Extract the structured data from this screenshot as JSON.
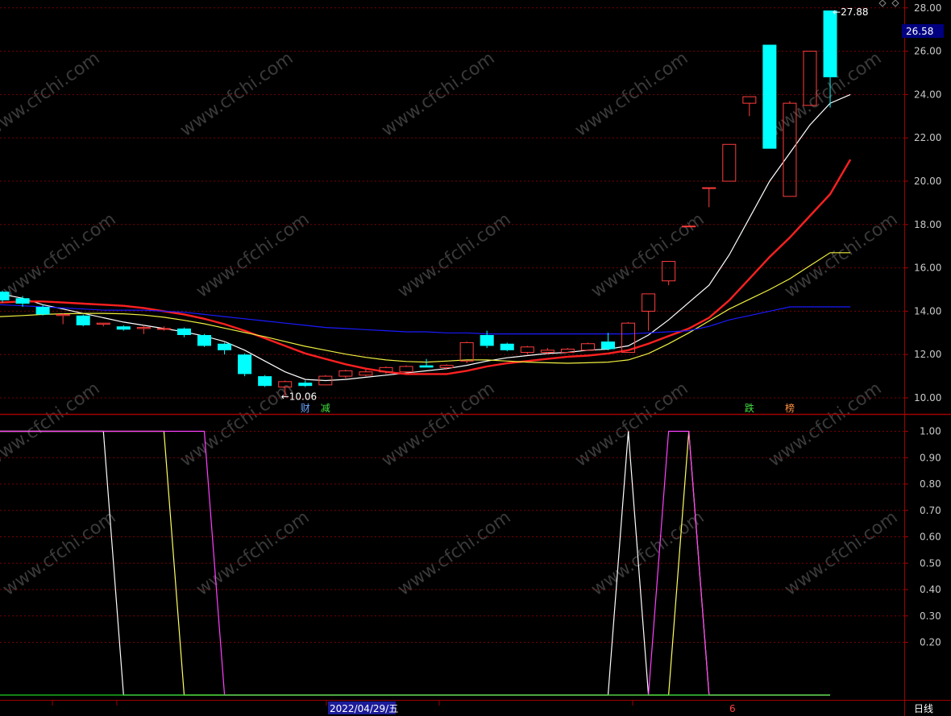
{
  "colors": {
    "background": "#000000",
    "grid": "#7a0000",
    "border": "#a00000",
    "axis_text": "#c8c8c8",
    "up_candle": "#ff3c3c",
    "down_candle": "#00ffff",
    "ma5": "#ffffff",
    "ma10": "#ff2020",
    "ma20": "#f0f040",
    "ma60": "#1a1aff",
    "ind_white": "#ffffff",
    "ind_yellow": "#ffff60",
    "ind_magenta": "#ff40ff",
    "ind_green": "#20d020",
    "price_tag_bg": "#000080"
  },
  "watermark": "www.cfchi.com",
  "labels": {
    "high": "27.88",
    "high_prefix": "←",
    "low": "10.06",
    "low_prefix": "←",
    "current_price": "26.58",
    "date": "2022/04/29/五",
    "period": "日线",
    "axis_marker": "6"
  },
  "event_markers": [
    {
      "text": "财",
      "color": "#6aa6ff",
      "candle": 15
    },
    {
      "text": "减",
      "color": "#40e040",
      "candle": 16
    },
    {
      "text": "跌",
      "color": "#40e040",
      "candle": 37
    },
    {
      "text": "榜",
      "color": "#ff9040",
      "candle": 39
    }
  ],
  "chart_data": [
    {
      "type": "candlestick",
      "title": "",
      "ylim": [
        9.5,
        28.4
      ],
      "yticks": [
        "10.00",
        "12.00",
        "14.00",
        "16.00",
        "18.00",
        "20.00",
        "22.00",
        "24.00",
        "26.00",
        "28.00"
      ],
      "candles": [
        {
          "o": 14.9,
          "h": 14.95,
          "l": 14.4,
          "c": 14.5
        },
        {
          "o": 14.6,
          "h": 14.7,
          "l": 14.2,
          "c": 14.35
        },
        {
          "o": 14.2,
          "h": 14.3,
          "l": 13.8,
          "c": 13.85
        },
        {
          "o": 13.8,
          "h": 13.9,
          "l": 13.4,
          "c": 13.85
        },
        {
          "o": 13.8,
          "h": 13.85,
          "l": 13.3,
          "c": 13.35
        },
        {
          "o": 13.4,
          "h": 13.45,
          "l": 13.3,
          "c": 13.45
        },
        {
          "o": 13.3,
          "h": 13.35,
          "l": 13.1,
          "c": 13.15
        },
        {
          "o": 13.2,
          "h": 13.35,
          "l": 12.95,
          "c": 13.25
        },
        {
          "o": 13.2,
          "h": 13.3,
          "l": 13.1,
          "c": 13.2
        },
        {
          "o": 13.2,
          "h": 13.25,
          "l": 12.8,
          "c": 12.9
        },
        {
          "o": 12.9,
          "h": 12.95,
          "l": 12.35,
          "c": 12.4
        },
        {
          "o": 12.5,
          "h": 12.55,
          "l": 12.0,
          "c": 12.2
        },
        {
          "o": 12.0,
          "h": 12.05,
          "l": 11.0,
          "c": 11.1
        },
        {
          "o": 11.0,
          "h": 11.05,
          "l": 10.5,
          "c": 10.55
        },
        {
          "o": 10.5,
          "h": 10.8,
          "l": 10.06,
          "c": 10.75
        },
        {
          "o": 10.7,
          "h": 10.8,
          "l": 10.5,
          "c": 10.55
        },
        {
          "o": 10.6,
          "h": 11.05,
          "l": 10.6,
          "c": 11.0
        },
        {
          "o": 11.0,
          "h": 11.3,
          "l": 10.9,
          "c": 11.25
        },
        {
          "o": 11.05,
          "h": 11.3,
          "l": 11.0,
          "c": 11.2
        },
        {
          "o": 11.2,
          "h": 11.45,
          "l": 11.1,
          "c": 11.4
        },
        {
          "o": 11.2,
          "h": 11.5,
          "l": 11.2,
          "c": 11.45
        },
        {
          "o": 11.5,
          "h": 11.8,
          "l": 11.4,
          "c": 11.4
        },
        {
          "o": 11.4,
          "h": 11.55,
          "l": 11.3,
          "c": 11.5
        },
        {
          "o": 11.7,
          "h": 12.6,
          "l": 11.6,
          "c": 12.55
        },
        {
          "o": 12.9,
          "h": 13.1,
          "l": 12.3,
          "c": 12.4
        },
        {
          "o": 12.5,
          "h": 12.55,
          "l": 12.15,
          "c": 12.2
        },
        {
          "o": 12.1,
          "h": 12.4,
          "l": 12.0,
          "c": 12.35
        },
        {
          "o": 12.1,
          "h": 12.3,
          "l": 12.0,
          "c": 12.2
        },
        {
          "o": 12.1,
          "h": 12.3,
          "l": 12.1,
          "c": 12.25
        },
        {
          "o": 12.2,
          "h": 12.55,
          "l": 12.2,
          "c": 12.5
        },
        {
          "o": 12.6,
          "h": 13.0,
          "l": 12.2,
          "c": 12.25
        },
        {
          "o": 12.1,
          "h": 13.5,
          "l": 12.1,
          "c": 13.45
        },
        {
          "o": 14.0,
          "h": 14.8,
          "l": 13.1,
          "c": 14.8
        },
        {
          "o": 15.4,
          "h": 16.3,
          "l": 15.2,
          "c": 16.3
        },
        {
          "o": 17.93,
          "h": 17.93,
          "l": 17.93,
          "c": 17.93
        },
        {
          "o": 19.7,
          "h": 19.7,
          "l": 18.8,
          "c": 19.7
        },
        {
          "o": 20.0,
          "h": 21.7,
          "l": 20.0,
          "c": 21.7
        },
        {
          "o": 23.6,
          "h": 23.9,
          "l": 23.0,
          "c": 23.9
        },
        {
          "o": 26.3,
          "h": 26.3,
          "l": 21.5,
          "c": 21.5
        },
        {
          "o": 19.3,
          "h": 23.7,
          "l": 19.3,
          "c": 23.6
        },
        {
          "o": 23.5,
          "h": 26.0,
          "l": 23.5,
          "c": 26.0
        },
        {
          "o": 27.88,
          "h": 27.88,
          "l": 23.4,
          "c": 24.8
        }
      ],
      "series": [
        {
          "name": "MA5",
          "values": [
            14.8,
            14.6,
            14.3,
            14.1,
            13.9,
            13.7,
            13.5,
            13.35,
            13.2,
            13.05,
            12.85,
            12.6,
            12.2,
            11.7,
            11.2,
            10.85,
            10.8,
            10.85,
            10.95,
            11.05,
            11.15,
            11.25,
            11.35,
            11.5,
            11.7,
            11.85,
            11.95,
            12.05,
            12.1,
            12.2,
            12.25,
            12.4,
            12.9,
            13.6,
            14.4,
            15.2,
            16.6,
            18.3,
            20.0,
            21.3,
            22.6,
            23.6,
            24.0
          ]
        },
        {
          "name": "MA10",
          "values": [
            14.4,
            14.45,
            14.45,
            14.4,
            14.35,
            14.3,
            14.25,
            14.15,
            14.0,
            13.85,
            13.65,
            13.4,
            13.1,
            12.75,
            12.4,
            12.05,
            11.8,
            11.55,
            11.35,
            11.2,
            11.1,
            11.1,
            11.1,
            11.25,
            11.45,
            11.6,
            11.7,
            11.8,
            11.9,
            11.95,
            12.05,
            12.2,
            12.5,
            12.85,
            13.2,
            13.7,
            14.5,
            15.5,
            16.5,
            17.4,
            18.4,
            19.4,
            21.0
          ]
        },
        {
          "name": "MA20",
          "values": [
            13.75,
            13.8,
            13.85,
            13.88,
            13.9,
            13.9,
            13.88,
            13.82,
            13.72,
            13.58,
            13.42,
            13.22,
            13.02,
            12.82,
            12.6,
            12.38,
            12.2,
            12.02,
            11.87,
            11.75,
            11.68,
            11.65,
            11.7,
            11.75,
            11.75,
            11.7,
            11.65,
            11.62,
            11.6,
            11.62,
            11.65,
            11.75,
            12.05,
            12.5,
            13.0,
            13.55,
            14.1,
            14.55,
            15.0,
            15.5,
            16.1,
            16.7,
            16.7
          ]
        },
        {
          "name": "MA60",
          "values": [
            14.3,
            14.25,
            14.2,
            14.15,
            14.1,
            14.05,
            14.05,
            14.05,
            14.0,
            13.95,
            13.85,
            13.75,
            13.65,
            13.55,
            13.45,
            13.35,
            13.25,
            13.2,
            13.15,
            13.1,
            13.05,
            13.05,
            13.0,
            13.0,
            12.95,
            12.95,
            12.95,
            12.95,
            12.95,
            12.95,
            12.95,
            12.95,
            13.0,
            13.05,
            13.1,
            13.3,
            13.6,
            13.8,
            14.0,
            14.2,
            14.2,
            14.2,
            14.2
          ]
        }
      ]
    },
    {
      "type": "line",
      "title": "",
      "ylim": [
        -0.03,
        1.03
      ],
      "yticks": [
        "0.20",
        "0.30",
        "0.40",
        "0.50",
        "0.60",
        "0.70",
        "0.80",
        "0.90",
        "1.00"
      ],
      "series": [
        {
          "name": "",
          "color_key": "ind_white",
          "points": [
            [
              -1,
              1
            ],
            [
              5,
              1
            ],
            [
              6,
              0
            ],
            [
              30,
              0
            ],
            [
              31,
              1
            ],
            [
              32,
              0
            ],
            [
              41,
              0
            ]
          ]
        },
        {
          "name": "",
          "color_key": "ind_yellow",
          "points": [
            [
              -1,
              1
            ],
            [
              8,
              1
            ],
            [
              9,
              0
            ],
            [
              33,
              0
            ],
            [
              34,
              1
            ],
            [
              35,
              0
            ],
            [
              41,
              0
            ]
          ]
        },
        {
          "name": "",
          "color_key": "ind_magenta",
          "points": [
            [
              -1,
              1
            ],
            [
              10,
              1
            ],
            [
              11,
              0
            ],
            [
              32,
              0
            ],
            [
              33,
              1
            ],
            [
              34,
              1
            ],
            [
              35,
              0
            ],
            [
              41,
              0
            ]
          ]
        },
        {
          "name": "",
          "color_key": "ind_green",
          "points": [
            [
              -1,
              0
            ],
            [
              41,
              0
            ]
          ]
        }
      ]
    }
  ]
}
